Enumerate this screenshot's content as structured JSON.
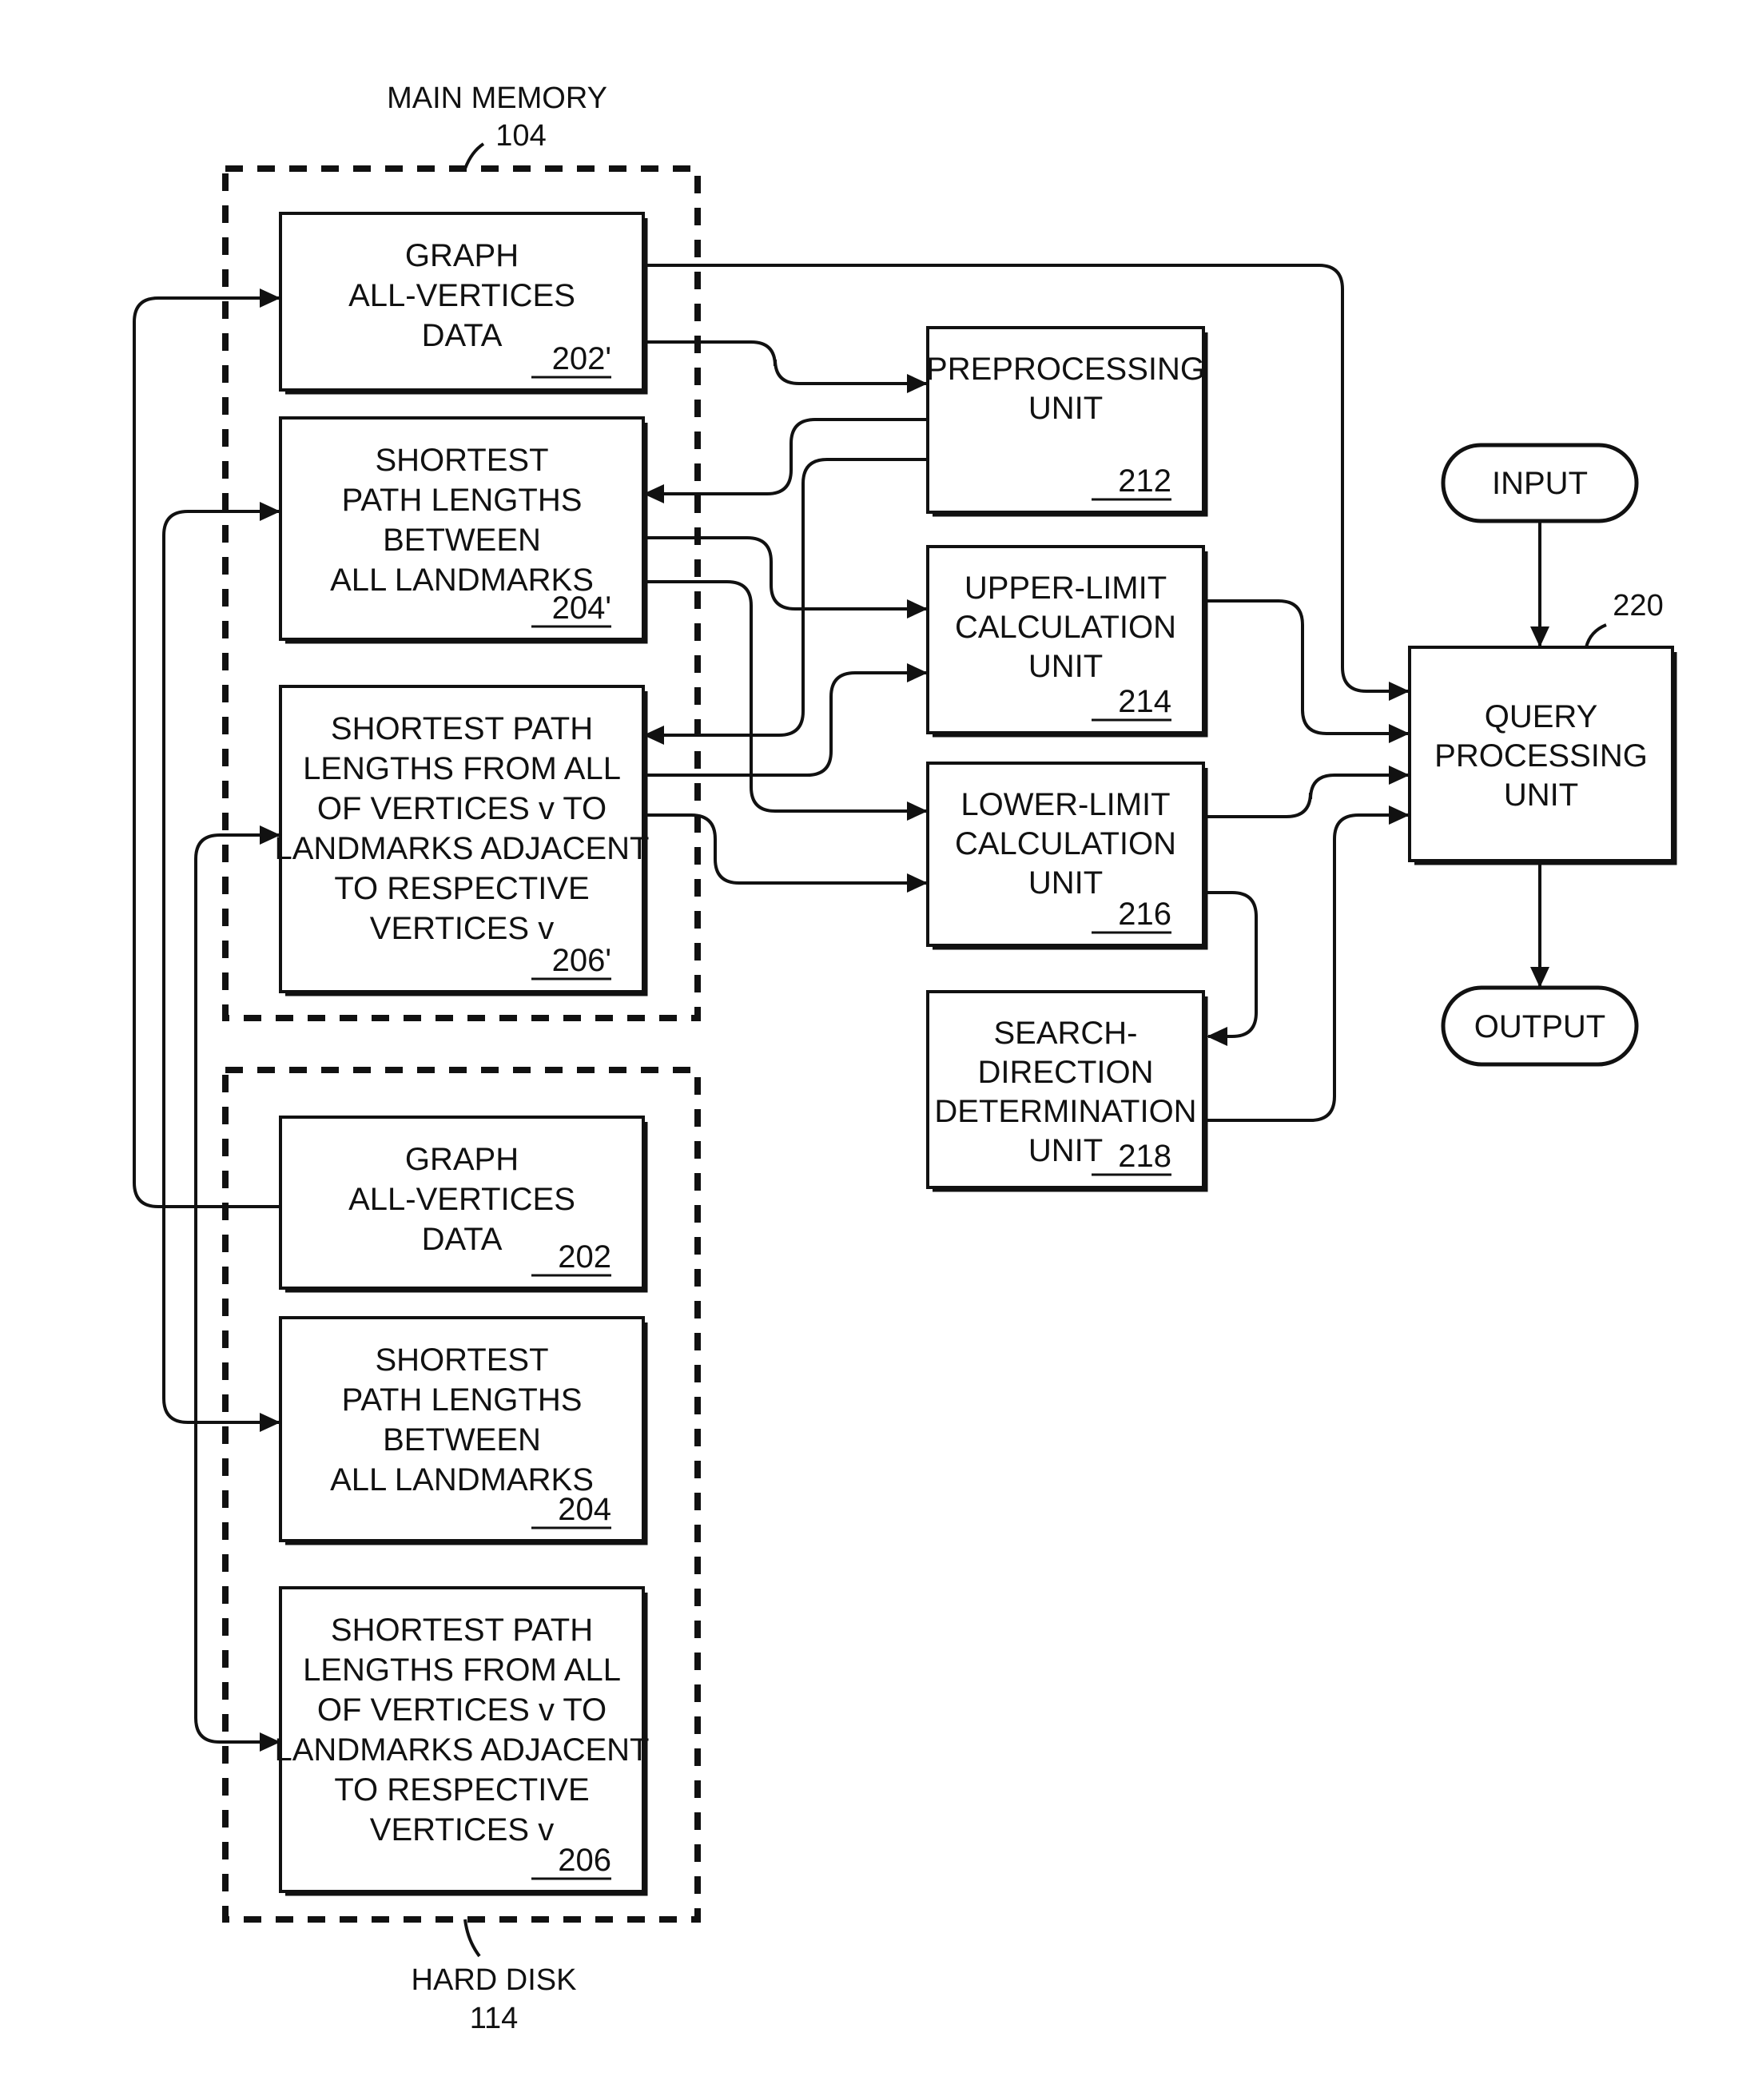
{
  "containers": {
    "main_memory": {
      "label": "MAIN MEMORY",
      "ref": "104"
    },
    "hard_disk": {
      "label": "HARD DISK",
      "ref": "114"
    }
  },
  "memory_boxes": [
    {
      "lines": [
        "GRAPH",
        "ALL-VERTICES",
        "DATA"
      ],
      "ref": "202'"
    },
    {
      "lines": [
        "SHORTEST",
        "PATH LENGTHS",
        "BETWEEN",
        "ALL LANDMARKS"
      ],
      "ref": "204'"
    },
    {
      "lines": [
        "SHORTEST PATH",
        "LENGTHS FROM ALL",
        "OF VERTICES v TO",
        "LANDMARKS ADJACENT",
        "TO RESPECTIVE",
        "VERTICES v"
      ],
      "ref": "206'"
    }
  ],
  "disk_boxes": [
    {
      "lines": [
        "GRAPH",
        "ALL-VERTICES",
        "DATA"
      ],
      "ref": "202"
    },
    {
      "lines": [
        "SHORTEST",
        "PATH LENGTHS",
        "BETWEEN",
        "ALL LANDMARKS"
      ],
      "ref": "204"
    },
    {
      "lines": [
        "SHORTEST PATH",
        "LENGTHS FROM ALL",
        "OF VERTICES v TO",
        "LANDMARKS ADJACENT",
        "TO RESPECTIVE",
        "VERTICES v"
      ],
      "ref": "206"
    }
  ],
  "units": [
    {
      "id": "preprocessing",
      "lines": [
        "PREPROCESSING",
        "UNIT"
      ],
      "ref": "212"
    },
    {
      "id": "upper-limit",
      "lines": [
        "UPPER-LIMIT",
        "CALCULATION",
        "UNIT"
      ],
      "ref": "214"
    },
    {
      "id": "lower-limit",
      "lines": [
        "LOWER-LIMIT",
        "CALCULATION",
        "UNIT"
      ],
      "ref": "216"
    },
    {
      "id": "search-direction",
      "lines": [
        "SEARCH-",
        "DIRECTION",
        "DETERMINATION",
        "UNIT"
      ],
      "ref": "218"
    }
  ],
  "query": {
    "lines": [
      "QUERY",
      "PROCESSING",
      "UNIT"
    ],
    "ref": "220"
  },
  "terminals": {
    "input": "INPUT",
    "output": "OUTPUT"
  }
}
